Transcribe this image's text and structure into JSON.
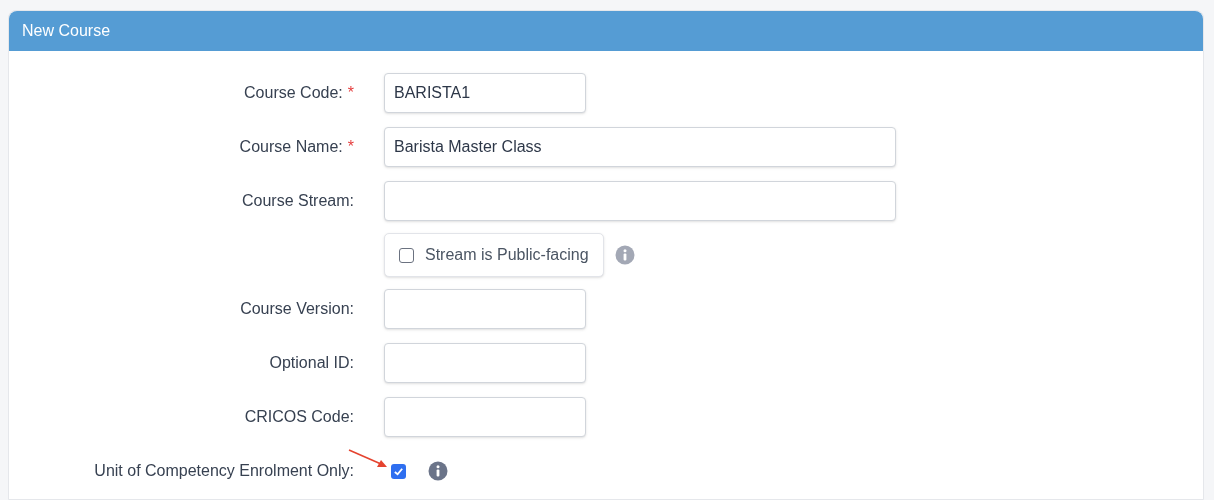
{
  "panel": {
    "title": "New Course"
  },
  "fields": [
    {
      "kind": "text",
      "label": "Course Code:",
      "required_mark": "*",
      "value": "BARISTA1"
    },
    {
      "kind": "text",
      "label": "Course Name:",
      "required_mark": "*",
      "value": "Barista Master Class"
    },
    {
      "kind": "text",
      "label": "Course Stream:"
    },
    {
      "kind": "toggle",
      "label": "Stream is Public-facing",
      "checked": false
    },
    {
      "kind": "text",
      "label": "Course Version:"
    },
    {
      "kind": "text",
      "label": "Optional ID:"
    },
    {
      "kind": "text",
      "label": "CRICOS Code:"
    },
    {
      "kind": "checkbox",
      "label": "Unit of Competency Enrolment Only:",
      "checked": true
    }
  ]
}
